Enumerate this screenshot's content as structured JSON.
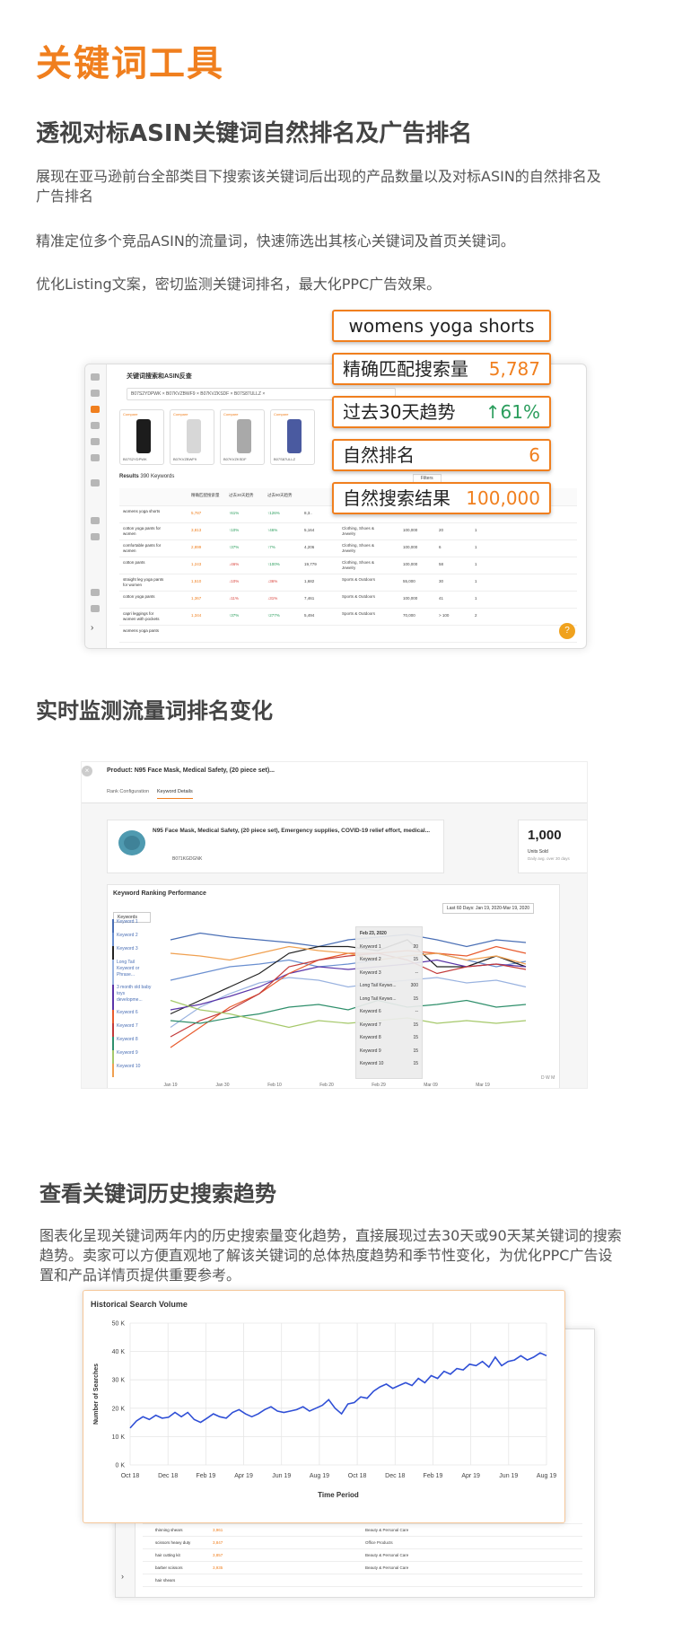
{
  "header": {
    "title": "关键词工具"
  },
  "section1": {
    "heading": "透视对标ASIN关键词自然排名及广告排名",
    "para1": "展现在亚马逊前台全部类目下搜索该关键词后出现的产品数量以及对标ASIN的自然排名及广告排名",
    "para2": "精准定位多个竞品ASIN的流量词，快速筛选出其核心关键词及首页关键词。",
    "para3": "优化Listing文案，密切监测关键词排名，最大化PPC广告效果。"
  },
  "callouts": {
    "keyword": "womens yoga shorts",
    "exact_label": "精确匹配搜索量",
    "exact_value": "5,787",
    "trend_label": "过去30天趋势",
    "trend_value": "↑61%",
    "rank_label": "自然排名",
    "rank_value": "6",
    "results_label": "自然搜索结果",
    "results_value": "100,000"
  },
  "shot1": {
    "title": "关键词搜索和ASIN反查",
    "chips": "B07S2YDPWK ×   B07KVZBWF9 ×   B07KVZKSDF ×   B07S87ULLZ ×",
    "products": [
      {
        "compare": "Compare",
        "asin": "B07S2YDPWK"
      },
      {
        "compare": "Compare",
        "asin": "B07KVZBWF9"
      },
      {
        "compare": "Compare",
        "asin": "B07KVZKSDF"
      },
      {
        "compare": "Compare",
        "asin": "B07S87ULLZ"
      }
    ],
    "results_label": "Results",
    "results_count": "390 Keywords",
    "col_exact": "精确匹配搜索量",
    "col_30": "过去30天趋势",
    "col_90": "过去90天趋势",
    "rows": [
      {
        "kw": "womens yoga shorts",
        "vol": "5,787",
        "t30": "↑61%",
        "t90": "↑126%",
        "a": "8,3..",
        "cat": "",
        "res": "",
        "r1": "",
        "r2": ""
      },
      {
        "kw": "cotton yoga pants for women",
        "vol": "3,813",
        "t30": "↑10%",
        "t90": "↑46%",
        "a": "5,164",
        "cat": "Clothing, Shoes & Jewelry",
        "res": "100,000",
        "r1": "20",
        "r2": "1"
      },
      {
        "kw": "comfortable pants for women",
        "vol": "2,899",
        "t30": "↑37%",
        "t90": "↑7%",
        "a": "4,206",
        "cat": "Clothing, Shoes & Jewelry",
        "res": "100,000",
        "r1": "6",
        "r2": "1"
      },
      {
        "kw": "cotton pants",
        "vol": "1,243",
        "t30": "↓46%",
        "t90": "↑100%",
        "a": "19,779",
        "cat": "Clothing, Shoes & Jewelry",
        "res": "100,000",
        "r1": "58",
        "r2": "1"
      },
      {
        "kw": "straight leg yoga pants for women",
        "vol": "1,510",
        "t30": "↓10%",
        "t90": "↓36%",
        "a": "1,682",
        "cat": "Sports & Outdoors",
        "res": "55,000",
        "r1": "30",
        "r2": "1"
      },
      {
        "kw": "cotton yoga pants",
        "vol": "1,367",
        "t30": "↓11%",
        "t90": "↓31%",
        "a": "7,461",
        "cat": "Sports & Outdoors",
        "res": "100,000",
        "r1": "41",
        "r2": "1"
      },
      {
        "kw": "capri leggings for women with pockets",
        "vol": "1,344",
        "t30": "↑37%",
        "t90": "↑277%",
        "a": "5,494",
        "cat": "Sports & Outdoors",
        "res": "70,000",
        "r1": "> 100",
        "r2": "2"
      },
      {
        "kw": "womens yoga pants",
        "vol": "",
        "t30": "",
        "t90": "",
        "a": "",
        "cat": "",
        "res": "",
        "r1": "",
        "r2": ""
      }
    ],
    "filters": "Filters"
  },
  "section2": {
    "heading": "实时监测流量词排名变化"
  },
  "shot2": {
    "product_title": "Product: N95 Face Mask, Medical Safety, (20 piece set)...",
    "tab_rank": "Rank Configuration",
    "tab_kw": "Keyword Details",
    "card_title": "N95 Face Mask, Medical Safety, (20 piece set), Emergency supplies, COVID-19 relief effort, medical...",
    "card_asin": "B071KGDGNK",
    "units_value": "1,000",
    "units_label": "Units Sold",
    "units_sub": "Daily avg. over 30 days",
    "chart_title": "Keyword Ranking Performance",
    "date_range": "Last 60 Days: Jan 19, 2020-Mar 19, 2020",
    "keywords_select": "Keywords",
    "keywords": [
      "Keyword 1",
      "Keyword 2",
      "Keyword 3",
      "Long Tail Keyword or Phrase...",
      "3 month old baby toys developme...",
      "Keyword 6",
      "Keyword 7",
      "Keyword 8",
      "Keyword 9",
      "Keyword 10"
    ],
    "tooltip_date": "Feb 23, 2020",
    "tooltip": [
      {
        "k": "Keyword 1",
        "v": "20"
      },
      {
        "k": "Keyword 2",
        "v": "15"
      },
      {
        "k": "Keyword 3",
        "v": "--"
      },
      {
        "k": "Long Tail Keywo...",
        "v": "300"
      },
      {
        "k": "Long Tail Keywo...",
        "v": "15"
      },
      {
        "k": "Keyword 6",
        "v": "--"
      },
      {
        "k": "Keyword 7",
        "v": "15"
      },
      {
        "k": "Keyword 8",
        "v": "15"
      },
      {
        "k": "Keyword 9",
        "v": "15"
      },
      {
        "k": "Keyword 10",
        "v": "15"
      }
    ],
    "y_ticks": [
      "1",
      "25",
      "50",
      "75",
      "100"
    ],
    "x_ticks": [
      "Jan 19",
      "Jan 30",
      "Feb 10",
      "Feb 20",
      "Feb 29",
      "Mar 09",
      "Mar 19"
    ],
    "granularity": "D  W  M"
  },
  "section3": {
    "heading": "查看关键词历史搜索趋势",
    "para": "图表化呈现关键词两年内的历史搜索量变化趋势，直接展现过去30天或90天某关键词的搜索趋势。卖家可以方便直观地了解该关键词的总体热度趋势和季节性变化，为优化PPC广告设置和产品详情页提供重要参考。"
  },
  "shot3_back": {
    "rows": [
      {
        "kw": "garden shears",
        "vol": "3,953",
        "cat": "Patio, Lawn & Garden"
      },
      {
        "kw": "thinning shears",
        "vol": "3,961",
        "cat": "Beauty & Personal Care"
      },
      {
        "kw": "scissors heavy duty",
        "vol": "3,847",
        "cat": "Office Products"
      },
      {
        "kw": "hair cutting kit",
        "vol": "3,857",
        "cat": "Beauty & Personal Care"
      },
      {
        "kw": "barber scissors",
        "vol": "3,935",
        "cat": "Beauty & Personal Care"
      },
      {
        "kw": "hair shears",
        "vol": "",
        "cat": ""
      }
    ]
  },
  "chart_data": {
    "type": "line",
    "title": "Historical Search Volume",
    "xlabel": "Time Period",
    "ylabel": "Number of Searches",
    "x_tick_labels": [
      "Oct 18",
      "Dec 18",
      "Feb 19",
      "Apr 19",
      "Jun 19",
      "Aug 19",
      "Oct 18",
      "Dec 18",
      "Feb 19",
      "Apr 19",
      "Jun 19",
      "Aug 19"
    ],
    "y_tick_labels": [
      "0 K",
      "10 K",
      "20 K",
      "30 K",
      "40 K",
      "50 K"
    ],
    "ylim": [
      0,
      50000
    ],
    "series": [
      {
        "color": "#2f4fd6",
        "values": [
          13000,
          15500,
          17000,
          16000,
          17500,
          16500,
          16800,
          18500,
          17000,
          18500,
          16000,
          15000,
          16500,
          18000,
          17000,
          16500,
          18500,
          19500,
          18000,
          17000,
          18000,
          19500,
          20500,
          19000,
          18500,
          19000,
          19500,
          20500,
          19000,
          20000,
          21000,
          23000,
          20000,
          18000,
          21500,
          22000,
          24000,
          23500,
          26000,
          27500,
          28500,
          27000,
          28000,
          29000,
          28000,
          30500,
          29000,
          31500,
          30500,
          33000,
          32000,
          34000,
          33500,
          35500,
          35000,
          36500,
          34500,
          38000,
          35000,
          36500,
          37000,
          38500,
          37000,
          38000,
          39500,
          38500
        ]
      }
    ],
    "grid": true
  }
}
